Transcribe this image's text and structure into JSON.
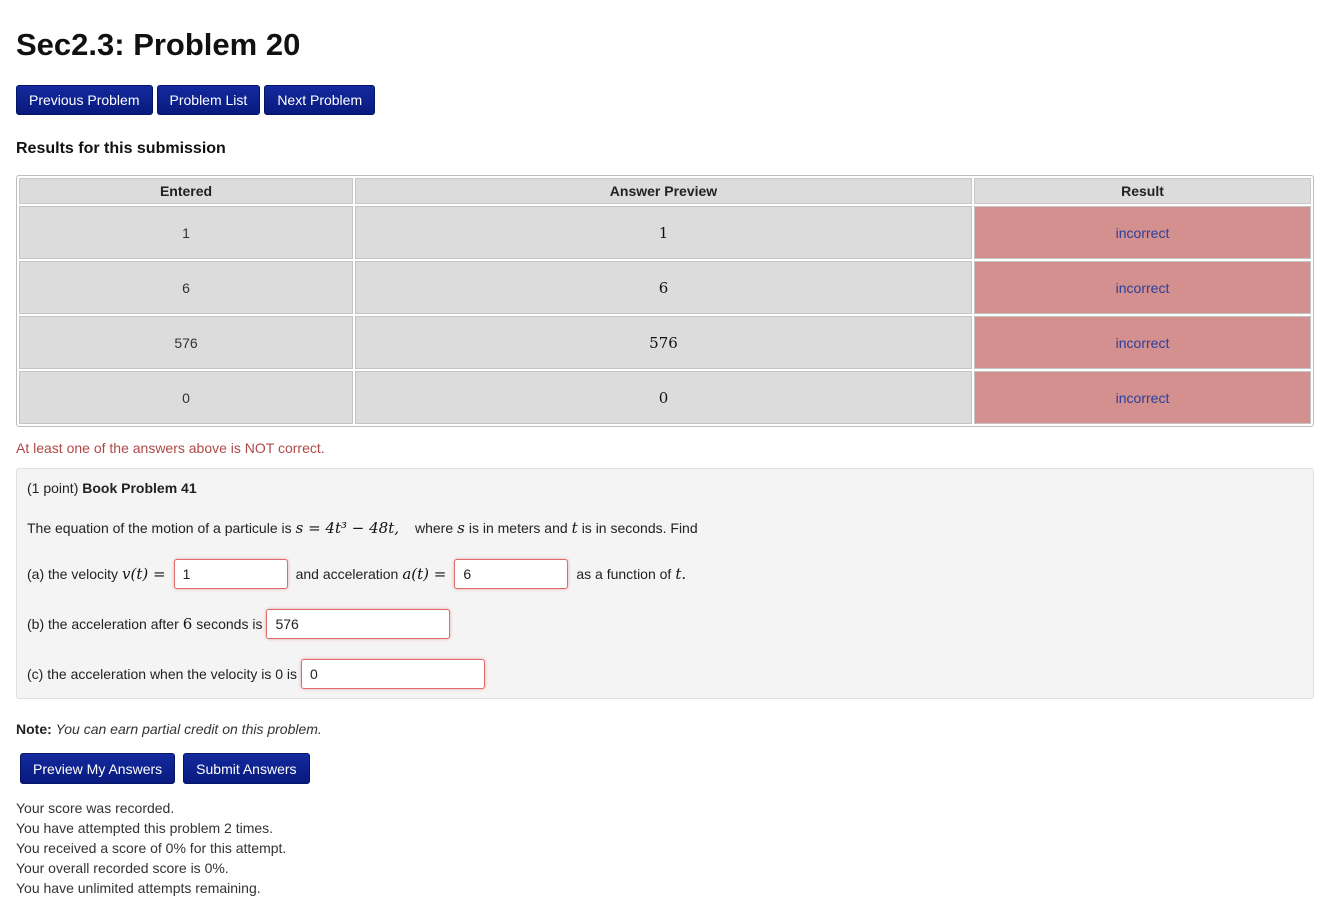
{
  "page": {
    "title": "Sec2.3: Problem 20"
  },
  "nav": {
    "previous_label": "Previous Problem",
    "list_label": "Problem List",
    "next_label": "Next Problem"
  },
  "results": {
    "title": "Results for this submission",
    "headers": [
      "Entered",
      "Answer Preview",
      "Result"
    ],
    "rows": [
      {
        "entered": "1",
        "preview": "1",
        "result": "incorrect"
      },
      {
        "entered": "6",
        "preview": "6",
        "result": "incorrect"
      },
      {
        "entered": "576",
        "preview": "576",
        "result": "incorrect"
      },
      {
        "entered": "0",
        "preview": "0",
        "result": "incorrect"
      }
    ],
    "warning": "At least one of the answers above is NOT correct."
  },
  "problem": {
    "points": "(1 point)",
    "name": "Book Problem 41",
    "intro_before": "The equation of the motion of a particule is",
    "equation": "s = 4t³ − 48t,",
    "intro_where": "where",
    "var_s": "s",
    "intro_mid": "is in meters and",
    "var_t": "t",
    "intro_after": "is in seconds. Find",
    "part_a_prefix": "(a) the velocity",
    "part_a_v": "v(t) =",
    "part_a_value1": "1",
    "part_a_middle": "and acceleration",
    "part_a_a": "a(t) =",
    "part_a_value2": "6",
    "part_a_suffix": "as a function of",
    "part_a_var": "t.",
    "part_b_prefix": "(b) the acceleration after",
    "part_b_num": "6",
    "part_b_suffix": "seconds is",
    "part_b_value": "576",
    "part_c_prefix": "(c) the acceleration when the velocity is 0 is",
    "part_c_value": "0"
  },
  "note": {
    "label": "Note:",
    "text": "You can earn partial credit on this problem."
  },
  "actions": {
    "preview_label": "Preview My Answers",
    "submit_label": "Submit Answers"
  },
  "status": [
    "Your score was recorded.",
    "You have attempted this problem 2 times.",
    "You received a score of 0% for this attempt.",
    "Your overall recorded score is 0%.",
    "You have unlimited attempts remaining."
  ],
  "colors": {
    "button": "#0b1f8a",
    "incorrect_cell": "#d48f8f",
    "warning_text": "#b04848"
  }
}
